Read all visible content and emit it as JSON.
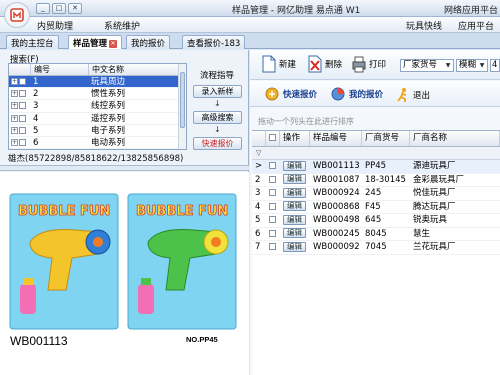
{
  "window": {
    "title": "样品管理 - 网亿助理 易点通 W1",
    "title_right": "网络应用平台"
  },
  "menubar": {
    "items": [
      "内贸助理",
      "系统维护"
    ],
    "right_items": [
      "玩具快线",
      "应用平台"
    ]
  },
  "tabs": [
    {
      "label": "我的主控台",
      "active": false
    },
    {
      "label": "样品管理",
      "active": true,
      "closable": true
    },
    {
      "label": "我的报价",
      "active": false
    },
    {
      "label": "查看报价-183",
      "active": false
    }
  ],
  "left": {
    "search_label": "搜索(F)",
    "category_table": {
      "columns": [
        "编号",
        "中文名称"
      ],
      "rows": [
        {
          "id": "1",
          "name": "玩具周边",
          "selected": true
        },
        {
          "id": "2",
          "name": "惯性系列",
          "selected": false
        },
        {
          "id": "3",
          "name": "线控系列",
          "selected": false
        },
        {
          "id": "4",
          "name": "遥控系列",
          "selected": false
        },
        {
          "id": "5",
          "name": "电子系列",
          "selected": false
        },
        {
          "id": "6",
          "name": "电动系列",
          "selected": false
        }
      ]
    },
    "flow": {
      "title": "流程指导",
      "steps": [
        "录入新样",
        "高级搜索",
        "快速报价"
      ]
    },
    "contact": "雄杰(85722898/85818622/13825856898)",
    "product": {
      "code": "WB001113",
      "package_no": "NO.PP45",
      "brand_text": "BUBBLE FUN"
    }
  },
  "toolbar": {
    "new_label": "新建",
    "delete_label": "删除",
    "print_label": "打印",
    "field_select": "厂家货号",
    "match_select": "模糊",
    "value_select": "4"
  },
  "toolbar2": {
    "quick_quote_label": "快速报价",
    "my_quote_label": "我的报价",
    "exit_label": "退出"
  },
  "grid": {
    "drag_hint": "拖动一个列头在此进行排序",
    "columns": [
      "操作",
      "样品编号",
      "厂商货号",
      "厂商名称"
    ],
    "edit_label": "编辑",
    "rows": [
      {
        "indicator": "> 1",
        "code": "WB001113",
        "factory_no": "PP45",
        "factory": "源迪玩具厂"
      },
      {
        "indicator": "2",
        "code": "WB001087",
        "factory_no": "18-30145",
        "factory": "金彩晨玩具厂"
      },
      {
        "indicator": "3",
        "code": "WB000924",
        "factory_no": "245",
        "factory": "悦佳玩具厂"
      },
      {
        "indicator": "4",
        "code": "WB000868",
        "factory_no": "F45",
        "factory": "腾达玩具厂"
      },
      {
        "indicator": "5",
        "code": "WB000498",
        "factory_no": "645",
        "factory": "锐奥玩具"
      },
      {
        "indicator": "6",
        "code": "WB000245",
        "factory_no": "8045",
        "factory": "慧生"
      },
      {
        "indicator": "7",
        "code": "WB000092",
        "factory_no": "7045",
        "factory": "兰花玩具厂"
      }
    ]
  },
  "colors": {
    "selection": "#3366cc",
    "accent_blue": "#1a3f8f",
    "tab_close": "#d9534f"
  }
}
